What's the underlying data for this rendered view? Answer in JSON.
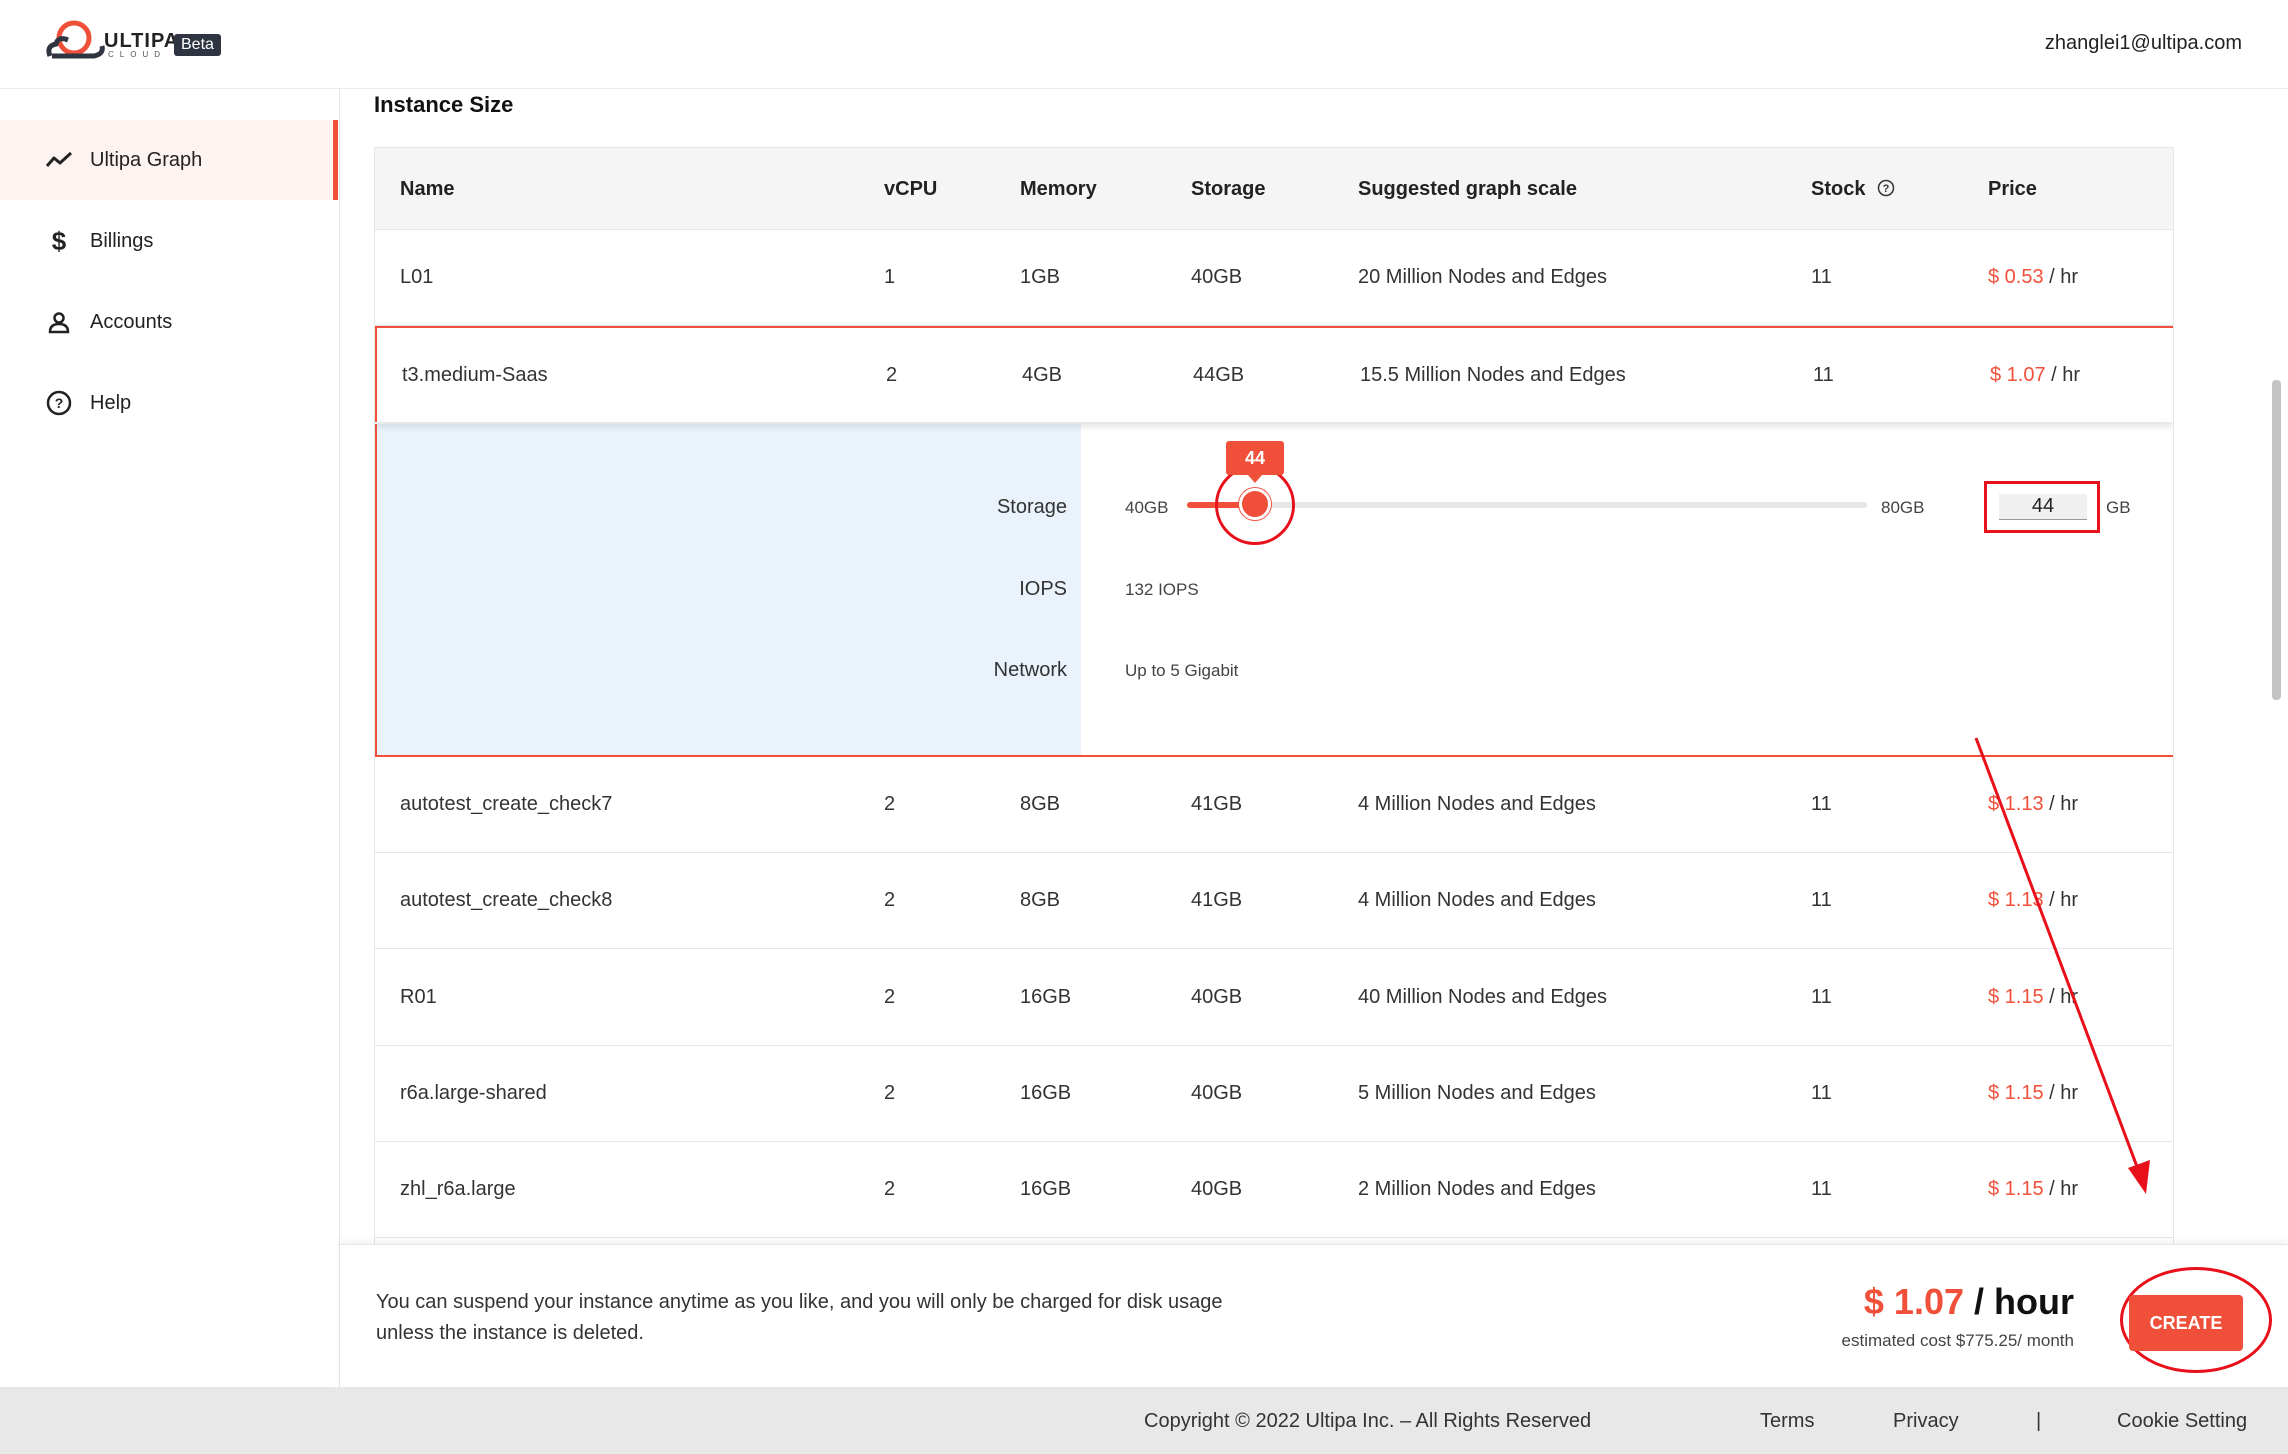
{
  "header": {
    "brand": "ULTIPA",
    "brand_sub": "CLOUD",
    "badge": "Beta",
    "user_email": "zhanglei1@ultipa.com"
  },
  "sidebar": {
    "items": [
      {
        "label": "Ultipa Graph",
        "icon": "trend-line-icon",
        "active": true
      },
      {
        "label": "Billings",
        "icon": "dollar-icon",
        "active": false
      },
      {
        "label": "Accounts",
        "icon": "user-icon",
        "active": false
      },
      {
        "label": "Help",
        "icon": "help-circle-icon",
        "active": false
      }
    ]
  },
  "main": {
    "section_title": "Instance Size",
    "columns": [
      "Name",
      "vCPU",
      "Memory",
      "Storage",
      "Suggested graph scale",
      "Stock",
      "Price"
    ],
    "rows": [
      {
        "name": "L01",
        "vcpu": "1",
        "memory": "1GB",
        "storage": "40GB",
        "scale": "20 Million Nodes and Edges",
        "stock": "11",
        "price": "$ 0.53",
        "unit": " / hr"
      },
      {
        "name": "t3.medium-Saas",
        "vcpu": "2",
        "memory": "4GB",
        "storage": "44GB",
        "scale": "15.5 Million Nodes and Edges",
        "stock": "11",
        "price": "$ 1.07",
        "unit": " / hr"
      },
      {
        "name": "autotest_create_check7",
        "vcpu": "2",
        "memory": "8GB",
        "storage": "41GB",
        "scale": "4 Million Nodes and Edges",
        "stock": "11",
        "price": "$ 1.13",
        "unit": " / hr"
      },
      {
        "name": "autotest_create_check8",
        "vcpu": "2",
        "memory": "8GB",
        "storage": "41GB",
        "scale": "4 Million Nodes and Edges",
        "stock": "11",
        "price": "$ 1.13",
        "unit": " / hr"
      },
      {
        "name": "R01",
        "vcpu": "2",
        "memory": "16GB",
        "storage": "40GB",
        "scale": "40 Million Nodes and Edges",
        "stock": "11",
        "price": "$ 1.15",
        "unit": " / hr"
      },
      {
        "name": "r6a.large-shared",
        "vcpu": "2",
        "memory": "16GB",
        "storage": "40GB",
        "scale": "5 Million Nodes and Edges",
        "stock": "11",
        "price": "$ 1.15",
        "unit": " / hr"
      },
      {
        "name": "zhl_r6a.large",
        "vcpu": "2",
        "memory": "16GB",
        "storage": "40GB",
        "scale": "2 Million Nodes and Edges",
        "stock": "11",
        "price": "$ 1.15",
        "unit": " / hr"
      }
    ],
    "detail": {
      "storage_label": "Storage",
      "slider_min": "40GB",
      "slider_max": "80GB",
      "slider_value": "44",
      "slider_fraction": 0.1,
      "storage_input": "44",
      "storage_unit": "GB",
      "iops_label": "IOPS",
      "iops_value": "132 IOPS",
      "network_label": "Network",
      "network_value": "Up to 5 Gigabit"
    }
  },
  "action_bar": {
    "notice": "You can suspend your instance anytime as you like, and you will only be charged for disk usage unless the instance is deleted.",
    "price": "$ 1.07",
    "price_unit": " / hour",
    "estimate": "estimated cost $775.25/ month",
    "create_label": "CREATE"
  },
  "footer": {
    "copyright": "Copyright © 2022 Ultipa Inc. – All Rights Reserved",
    "terms": "Terms",
    "privacy": "Privacy",
    "separator": "|",
    "cookie": "Cookie Setting"
  },
  "colors": {
    "accent": "#f0503a",
    "annotation": "#e8101a",
    "detail_panel_bg": "#eaf2fb"
  }
}
